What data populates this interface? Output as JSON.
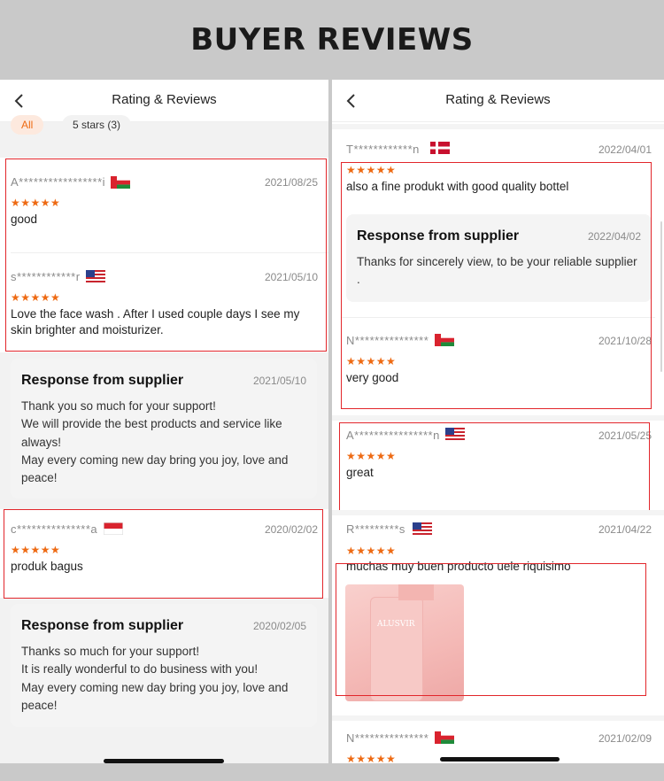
{
  "banner": {
    "title": "BUYER REVIEWS"
  },
  "left_screen": {
    "header_title": "Rating & Reviews",
    "filters": [
      {
        "label": "All",
        "active": true
      },
      {
        "label": "5 stars (3)",
        "active": false
      }
    ],
    "reviews": [
      {
        "user": "A*****************i",
        "flag": "oman",
        "date": "2021/08/25",
        "stars": "★★★★★",
        "text": "good"
      },
      {
        "user": "s************r",
        "flag": "usa",
        "date": "2021/05/10",
        "stars": "★★★★★",
        "text": "Love the face wash . After I used couple days I see my skin brighter and moisturizer."
      },
      {
        "user": "c***************a",
        "flag": "indonesia",
        "date": "2020/02/02",
        "stars": "★★★★★",
        "text": "produk bagus"
      }
    ],
    "responses": [
      {
        "title": "Response from supplier",
        "date": "2021/05/10",
        "lines": [
          "Thank you so much for your support!",
          "We will provide the best products and service like always!",
          "May every coming new day bring you joy, love and peace!"
        ]
      },
      {
        "title": "Response from supplier",
        "date": "2020/02/05",
        "lines": [
          "Thanks so much for your support!",
          "It is really wonderful to do business with you!",
          "May every coming new day bring you joy, love and peace!"
        ]
      }
    ]
  },
  "right_screen": {
    "header_title": "Rating & Reviews",
    "reviews": [
      {
        "user": "T************n",
        "flag": "denmark",
        "date": "2022/04/01",
        "stars": "★★★★★",
        "text": "also a fine produkt with good quality bottel"
      },
      {
        "user": "N***************",
        "flag": "oman",
        "date": "2021/10/28",
        "stars": "★★★★★",
        "text": "very good"
      },
      {
        "user": "A****************n",
        "flag": "usa",
        "date": "2021/05/25",
        "stars": "★★★★★",
        "text": "great"
      },
      {
        "user": "R*********s",
        "flag": "usa",
        "date": "2021/04/22",
        "stars": "★★★★★",
        "text": "muchas muy buen producto uele riquisimo"
      },
      {
        "user": "N***************",
        "flag": "oman",
        "date": "2021/02/09",
        "stars": "★★★★★",
        "text": ""
      }
    ],
    "response": {
      "title": "Response from supplier",
      "date": "2022/04/02",
      "lines": [
        "Thanks for sincerely view,  to be your reliable supplier ."
      ]
    },
    "photo_brand": "ALUSVIR"
  },
  "colors": {
    "accent": "#ee6a13",
    "highlight": "#e2262b",
    "banner_bg": "#c9c9c9"
  }
}
